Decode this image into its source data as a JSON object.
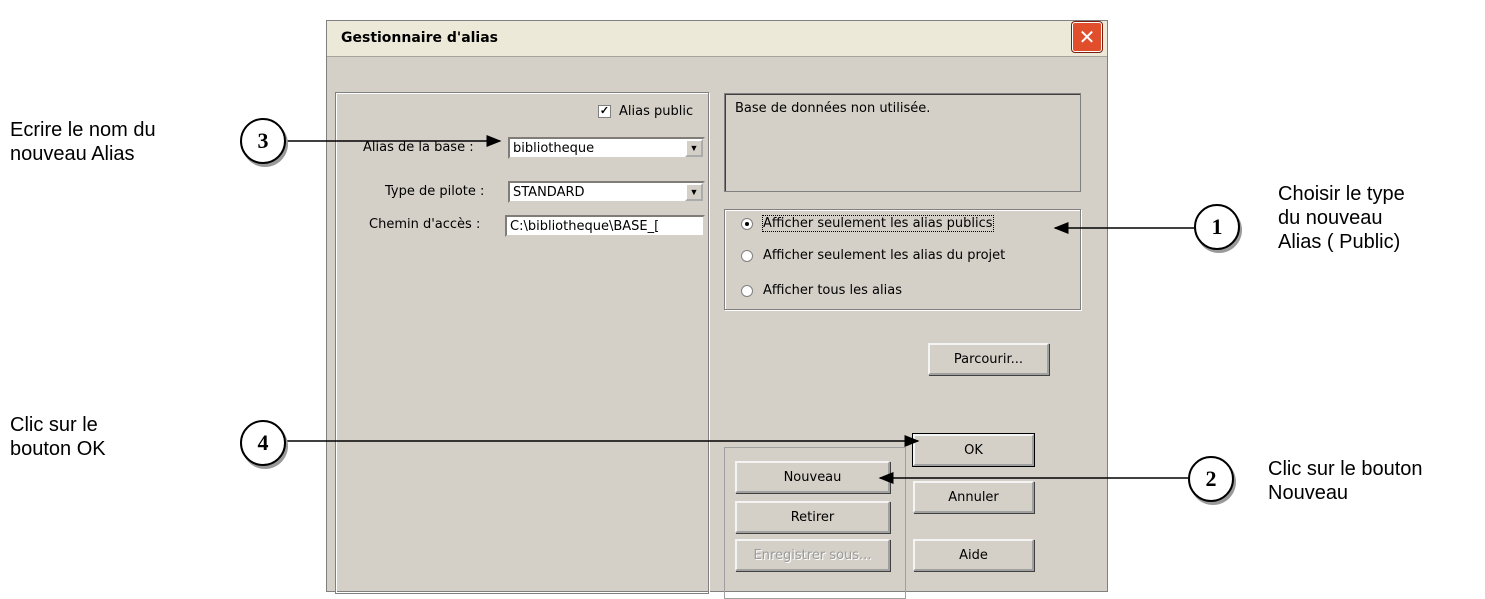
{
  "dialog": {
    "title": "Gestionnaire d'alias",
    "close_glyph": "✕"
  },
  "left_panel": {
    "public_alias_checkbox": {
      "label": "Alias public",
      "checked": true,
      "check_glyph": "✓"
    },
    "base_alias": {
      "label": "Alias de la base :",
      "value": "bibliotheque"
    },
    "driver_type": {
      "label": "Type de pilote :",
      "value": "STANDARD"
    },
    "path": {
      "label": "Chemin d'accès :",
      "value": "C:\\bibliotheque\\BASE_["
    }
  },
  "info_box": {
    "text": "Base de données non utilisée."
  },
  "filter_options": {
    "selected_index": 0,
    "items": [
      {
        "label": "Afficher seulement les alias publics"
      },
      {
        "label": "Afficher seulement les alias du projet"
      },
      {
        "label": "Afficher tous les alias"
      }
    ]
  },
  "buttons": {
    "browse": "Parcourir...",
    "ok": "OK",
    "new": "Nouveau",
    "cancel": "Annuler",
    "remove": "Retirer",
    "save_as": "Enregistrer sous...",
    "help": "Aide"
  },
  "annotations": {
    "step1": {
      "number": "1",
      "text_lines": [
        "Choisir le type",
        "du nouveau",
        "Alias ( Public)"
      ]
    },
    "step2": {
      "number": "2",
      "text_lines": [
        "Clic sur le bouton",
        "Nouveau"
      ]
    },
    "step3": {
      "number": "3",
      "text_lines": [
        "Ecrire le nom du",
        "nouveau Alias"
      ]
    },
    "step4": {
      "number": "4",
      "text_lines": [
        "Clic sur le",
        "bouton OK"
      ]
    }
  },
  "icons": {
    "dropdown": "chevron-down-icon",
    "close": "close-icon",
    "arrow": "arrow-icon"
  },
  "colors": {
    "dialog_bg": "#d4d0c8",
    "titlebar_bg": "#ece9d8",
    "close_red": "#e04e2c"
  }
}
